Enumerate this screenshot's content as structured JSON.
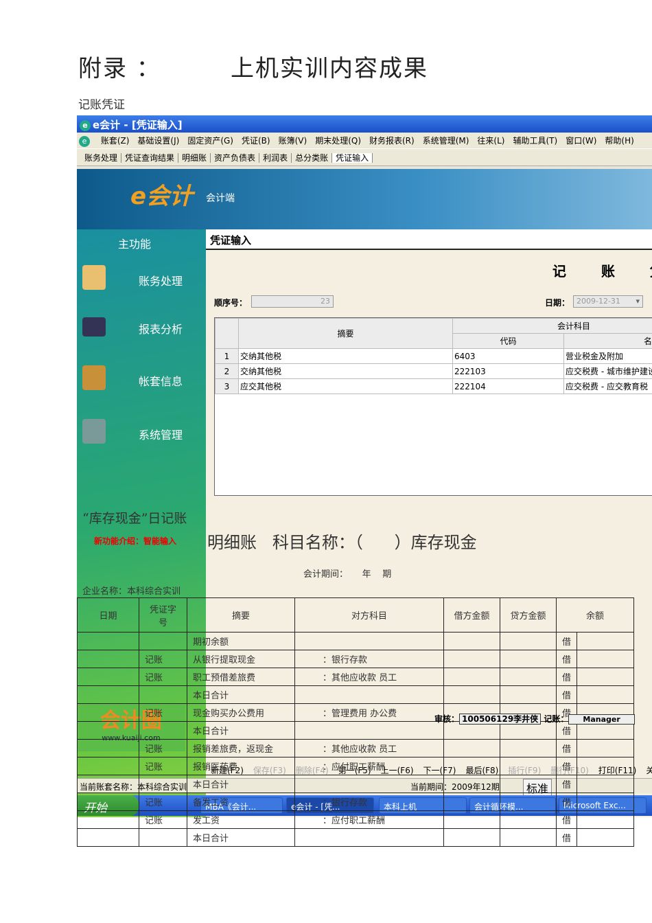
{
  "heading": {
    "left": "附录  ：",
    "right": "上机实训内容成果"
  },
  "subheading": "记账凭证",
  "app": {
    "title": "e会计 - [凭证输入]",
    "menu": [
      "账套(Z)",
      "基础设置(J)",
      "固定资产(G)",
      "凭证(B)",
      "账簿(V)",
      "期末处理(Q)",
      "财务报表(R)",
      "系统管理(M)",
      "往来(L)",
      "辅助工具(T)",
      "窗口(W)",
      "帮助(H)"
    ],
    "tabs": [
      "账务处理",
      "凭证查询结果",
      "明细账",
      "资产负债表",
      "利润表",
      "总分类账",
      "凭证输入"
    ],
    "logo": "e会计",
    "banner_label": "会计端",
    "sidebar": {
      "header": "主功能",
      "items": [
        "账务处理",
        "报表分析",
        "帐套信息",
        "系统管理"
      ],
      "promo": "新功能介绍：智能输入",
      "brand": "会计圈",
      "brand_url": "www.kuaiji.com"
    },
    "panel_title": "凭证输入",
    "voucher_title": "记 账 凭 证",
    "seq_label": "顺序号：",
    "seq_value": "23",
    "date_label": "日期：",
    "date_value": "2009-12-31",
    "grid": {
      "h_summary": "摘要",
      "h_account": "会计科目",
      "h_code": "代码",
      "h_name": "名称",
      "rows": [
        {
          "n": "1",
          "summary": "交纳其他税",
          "code": "6403",
          "name": "营业税金及附加"
        },
        {
          "n": "2",
          "summary": "交纳其他税",
          "code": "222103",
          "name": "应交税费 - 城市维护建设税"
        },
        {
          "n": "3",
          "summary": "应交其他税",
          "code": "222104",
          "name": "应交税费 - 应交教育税"
        }
      ]
    },
    "audit_label": "审核：",
    "audit_value": "100506129李井侠",
    "post_label": "记账：",
    "post_value": "Manager",
    "buttons": [
      "新建(F2)",
      "保存(F3)",
      "删除(F4)",
      "第一(F5)",
      "上一(F6)",
      "下一(F7)",
      "最后(F8)",
      "插行(F9)",
      "删行(F10)",
      "打印(F11)",
      "关"
    ],
    "status": {
      "account": "当前账套名称：本科综合实训",
      "period": "当前期间：2009年12期",
      "ime": "标准"
    },
    "taskbar": {
      "start": "开始",
      "items": [
        "MBA《会计...",
        "e会计 - [凭...",
        "本科上机",
        "会计循环模...",
        "Microsoft Exc..."
      ]
    }
  },
  "ledger": {
    "caption": "“库存现金”日记账",
    "title": "明细账   科目名称：（      ）库存现金",
    "period": "会计期间：     年    期",
    "company": "企业名称：本科综合实训",
    "headers": [
      "日期",
      "凭证字号",
      "摘要",
      "对方科目",
      "借方金额",
      "贷方金额",
      "余额"
    ],
    "rows": [
      {
        "type": "",
        "summary": "期初余额",
        "contra": "",
        "dir": "借"
      },
      {
        "type": "记账",
        "summary": "从银行提取现金",
        "contra": "：银行存款",
        "dir": "借"
      },
      {
        "type": "记账",
        "summary": "职工预借差旅费",
        "contra": "：其他应收款    员工",
        "dir": "借"
      },
      {
        "type": "",
        "summary": "本日合计",
        "contra": "",
        "dir": "借"
      },
      {
        "type": "记账",
        "summary": "现金购买办公费用",
        "contra": "：管理费用    办公费",
        "dir": "借"
      },
      {
        "type": "",
        "summary": "本日合计",
        "contra": "",
        "dir": "借"
      },
      {
        "type": "记账",
        "summary": "报销差旅费，返现金",
        "contra": "：其他应收款    员工",
        "dir": "借"
      },
      {
        "type": "记账",
        "summary": "报销医药费",
        "contra": "：应付职工薪酬",
        "dir": "借"
      },
      {
        "type": "",
        "summary": "本日合计",
        "contra": "",
        "dir": "借"
      },
      {
        "type": "记账",
        "summary": "备发工资",
        "contra": "：银行存款",
        "dir": "借"
      },
      {
        "type": "记账",
        "summary": "发工资",
        "contra": "：应付职工薪酬",
        "dir": "借"
      },
      {
        "type": "",
        "summary": "本日合计",
        "contra": "",
        "dir": "借"
      }
    ]
  }
}
